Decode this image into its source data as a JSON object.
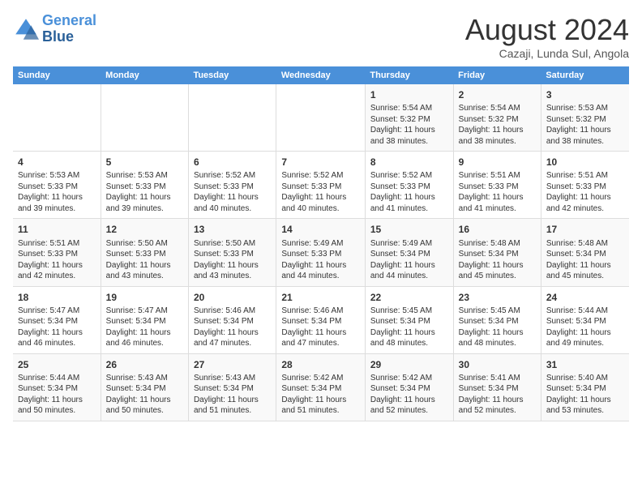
{
  "header": {
    "logo_line1": "General",
    "logo_line2": "Blue",
    "month": "August 2024",
    "location": "Cazaji, Lunda Sul, Angola"
  },
  "days_of_week": [
    "Sunday",
    "Monday",
    "Tuesday",
    "Wednesday",
    "Thursday",
    "Friday",
    "Saturday"
  ],
  "weeks": [
    [
      {
        "day": "",
        "content": ""
      },
      {
        "day": "",
        "content": ""
      },
      {
        "day": "",
        "content": ""
      },
      {
        "day": "",
        "content": ""
      },
      {
        "day": "1",
        "content": "Sunrise: 5:54 AM\nSunset: 5:32 PM\nDaylight: 11 hours and 38 minutes."
      },
      {
        "day": "2",
        "content": "Sunrise: 5:54 AM\nSunset: 5:32 PM\nDaylight: 11 hours and 38 minutes."
      },
      {
        "day": "3",
        "content": "Sunrise: 5:53 AM\nSunset: 5:32 PM\nDaylight: 11 hours and 38 minutes."
      }
    ],
    [
      {
        "day": "4",
        "content": "Sunrise: 5:53 AM\nSunset: 5:33 PM\nDaylight: 11 hours and 39 minutes."
      },
      {
        "day": "5",
        "content": "Sunrise: 5:53 AM\nSunset: 5:33 PM\nDaylight: 11 hours and 39 minutes."
      },
      {
        "day": "6",
        "content": "Sunrise: 5:52 AM\nSunset: 5:33 PM\nDaylight: 11 hours and 40 minutes."
      },
      {
        "day": "7",
        "content": "Sunrise: 5:52 AM\nSunset: 5:33 PM\nDaylight: 11 hours and 40 minutes."
      },
      {
        "day": "8",
        "content": "Sunrise: 5:52 AM\nSunset: 5:33 PM\nDaylight: 11 hours and 41 minutes."
      },
      {
        "day": "9",
        "content": "Sunrise: 5:51 AM\nSunset: 5:33 PM\nDaylight: 11 hours and 41 minutes."
      },
      {
        "day": "10",
        "content": "Sunrise: 5:51 AM\nSunset: 5:33 PM\nDaylight: 11 hours and 42 minutes."
      }
    ],
    [
      {
        "day": "11",
        "content": "Sunrise: 5:51 AM\nSunset: 5:33 PM\nDaylight: 11 hours and 42 minutes."
      },
      {
        "day": "12",
        "content": "Sunrise: 5:50 AM\nSunset: 5:33 PM\nDaylight: 11 hours and 43 minutes."
      },
      {
        "day": "13",
        "content": "Sunrise: 5:50 AM\nSunset: 5:33 PM\nDaylight: 11 hours and 43 minutes."
      },
      {
        "day": "14",
        "content": "Sunrise: 5:49 AM\nSunset: 5:33 PM\nDaylight: 11 hours and 44 minutes."
      },
      {
        "day": "15",
        "content": "Sunrise: 5:49 AM\nSunset: 5:34 PM\nDaylight: 11 hours and 44 minutes."
      },
      {
        "day": "16",
        "content": "Sunrise: 5:48 AM\nSunset: 5:34 PM\nDaylight: 11 hours and 45 minutes."
      },
      {
        "day": "17",
        "content": "Sunrise: 5:48 AM\nSunset: 5:34 PM\nDaylight: 11 hours and 45 minutes."
      }
    ],
    [
      {
        "day": "18",
        "content": "Sunrise: 5:47 AM\nSunset: 5:34 PM\nDaylight: 11 hours and 46 minutes."
      },
      {
        "day": "19",
        "content": "Sunrise: 5:47 AM\nSunset: 5:34 PM\nDaylight: 11 hours and 46 minutes."
      },
      {
        "day": "20",
        "content": "Sunrise: 5:46 AM\nSunset: 5:34 PM\nDaylight: 11 hours and 47 minutes."
      },
      {
        "day": "21",
        "content": "Sunrise: 5:46 AM\nSunset: 5:34 PM\nDaylight: 11 hours and 47 minutes."
      },
      {
        "day": "22",
        "content": "Sunrise: 5:45 AM\nSunset: 5:34 PM\nDaylight: 11 hours and 48 minutes."
      },
      {
        "day": "23",
        "content": "Sunrise: 5:45 AM\nSunset: 5:34 PM\nDaylight: 11 hours and 48 minutes."
      },
      {
        "day": "24",
        "content": "Sunrise: 5:44 AM\nSunset: 5:34 PM\nDaylight: 11 hours and 49 minutes."
      }
    ],
    [
      {
        "day": "25",
        "content": "Sunrise: 5:44 AM\nSunset: 5:34 PM\nDaylight: 11 hours and 50 minutes."
      },
      {
        "day": "26",
        "content": "Sunrise: 5:43 AM\nSunset: 5:34 PM\nDaylight: 11 hours and 50 minutes."
      },
      {
        "day": "27",
        "content": "Sunrise: 5:43 AM\nSunset: 5:34 PM\nDaylight: 11 hours and 51 minutes."
      },
      {
        "day": "28",
        "content": "Sunrise: 5:42 AM\nSunset: 5:34 PM\nDaylight: 11 hours and 51 minutes."
      },
      {
        "day": "29",
        "content": "Sunrise: 5:42 AM\nSunset: 5:34 PM\nDaylight: 11 hours and 52 minutes."
      },
      {
        "day": "30",
        "content": "Sunrise: 5:41 AM\nSunset: 5:34 PM\nDaylight: 11 hours and 52 minutes."
      },
      {
        "day": "31",
        "content": "Sunrise: 5:40 AM\nSunset: 5:34 PM\nDaylight: 11 hours and 53 minutes."
      }
    ]
  ]
}
